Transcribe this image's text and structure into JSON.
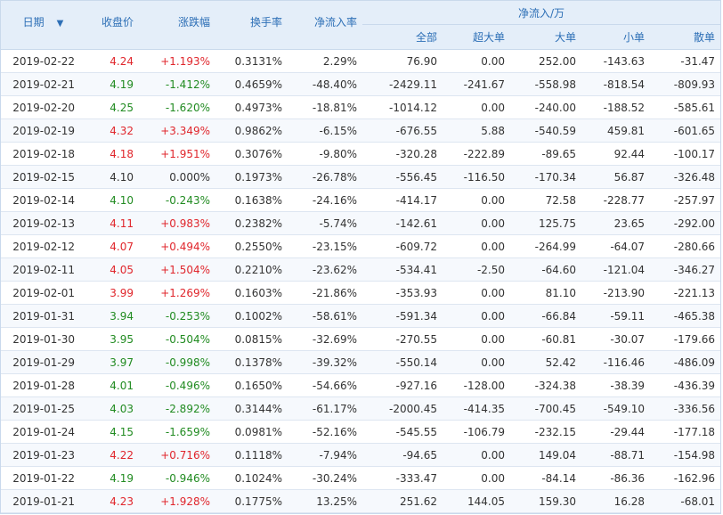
{
  "header": {
    "date": "日期",
    "close": "收盘价",
    "change": "涨跌幅",
    "turnover": "换手率",
    "net_pct": "净流入率",
    "net_group": "净流入/万",
    "all": "全部",
    "super_large": "超大单",
    "large": "大单",
    "small": "小单",
    "retail": "散单"
  },
  "sort_icon": "arrow-down-icon",
  "colors": {
    "up": "#e0262c",
    "down": "#218b21",
    "header_text": "#2d6fb6",
    "header_bg": "#e4eef9"
  },
  "rows": [
    {
      "date": "2019-02-22",
      "close": "4.24",
      "change": "+1.193%",
      "turnover": "0.3131%",
      "net_pct": "2.29%",
      "all": "76.90",
      "super": "0.00",
      "big": "252.00",
      "small": "-143.63",
      "retail": "-31.47",
      "trend": "up"
    },
    {
      "date": "2019-02-21",
      "close": "4.19",
      "change": "-1.412%",
      "turnover": "0.4659%",
      "net_pct": "-48.40%",
      "all": "-2429.11",
      "super": "-241.67",
      "big": "-558.98",
      "small": "-818.54",
      "retail": "-809.93",
      "trend": "down"
    },
    {
      "date": "2019-02-20",
      "close": "4.25",
      "change": "-1.620%",
      "turnover": "0.4973%",
      "net_pct": "-18.81%",
      "all": "-1014.12",
      "super": "0.00",
      "big": "-240.00",
      "small": "-188.52",
      "retail": "-585.61",
      "trend": "down"
    },
    {
      "date": "2019-02-19",
      "close": "4.32",
      "change": "+3.349%",
      "turnover": "0.9862%",
      "net_pct": "-6.15%",
      "all": "-676.55",
      "super": "5.88",
      "big": "-540.59",
      "small": "459.81",
      "retail": "-601.65",
      "trend": "up"
    },
    {
      "date": "2019-02-18",
      "close": "4.18",
      "change": "+1.951%",
      "turnover": "0.3076%",
      "net_pct": "-9.80%",
      "all": "-320.28",
      "super": "-222.89",
      "big": "-89.65",
      "small": "92.44",
      "retail": "-100.17",
      "trend": "up"
    },
    {
      "date": "2019-02-15",
      "close": "4.10",
      "change": "0.000%",
      "turnover": "0.1973%",
      "net_pct": "-26.78%",
      "all": "-556.45",
      "super": "-116.50",
      "big": "-170.34",
      "small": "56.87",
      "retail": "-326.48",
      "trend": "flat"
    },
    {
      "date": "2019-02-14",
      "close": "4.10",
      "change": "-0.243%",
      "turnover": "0.1638%",
      "net_pct": "-24.16%",
      "all": "-414.17",
      "super": "0.00",
      "big": "72.58",
      "small": "-228.77",
      "retail": "-257.97",
      "trend": "down"
    },
    {
      "date": "2019-02-13",
      "close": "4.11",
      "change": "+0.983%",
      "turnover": "0.2382%",
      "net_pct": "-5.74%",
      "all": "-142.61",
      "super": "0.00",
      "big": "125.75",
      "small": "23.65",
      "retail": "-292.00",
      "trend": "up"
    },
    {
      "date": "2019-02-12",
      "close": "4.07",
      "change": "+0.494%",
      "turnover": "0.2550%",
      "net_pct": "-23.15%",
      "all": "-609.72",
      "super": "0.00",
      "big": "-264.99",
      "small": "-64.07",
      "retail": "-280.66",
      "trend": "up"
    },
    {
      "date": "2019-02-11",
      "close": "4.05",
      "change": "+1.504%",
      "turnover": "0.2210%",
      "net_pct": "-23.62%",
      "all": "-534.41",
      "super": "-2.50",
      "big": "-64.60",
      "small": "-121.04",
      "retail": "-346.27",
      "trend": "up"
    },
    {
      "date": "2019-02-01",
      "close": "3.99",
      "change": "+1.269%",
      "turnover": "0.1603%",
      "net_pct": "-21.86%",
      "all": "-353.93",
      "super": "0.00",
      "big": "81.10",
      "small": "-213.90",
      "retail": "-221.13",
      "trend": "up"
    },
    {
      "date": "2019-01-31",
      "close": "3.94",
      "change": "-0.253%",
      "turnover": "0.1002%",
      "net_pct": "-58.61%",
      "all": "-591.34",
      "super": "0.00",
      "big": "-66.84",
      "small": "-59.11",
      "retail": "-465.38",
      "trend": "down"
    },
    {
      "date": "2019-01-30",
      "close": "3.95",
      "change": "-0.504%",
      "turnover": "0.0815%",
      "net_pct": "-32.69%",
      "all": "-270.55",
      "super": "0.00",
      "big": "-60.81",
      "small": "-30.07",
      "retail": "-179.66",
      "trend": "down"
    },
    {
      "date": "2019-01-29",
      "close": "3.97",
      "change": "-0.998%",
      "turnover": "0.1378%",
      "net_pct": "-39.32%",
      "all": "-550.14",
      "super": "0.00",
      "big": "52.42",
      "small": "-116.46",
      "retail": "-486.09",
      "trend": "down"
    },
    {
      "date": "2019-01-28",
      "close": "4.01",
      "change": "-0.496%",
      "turnover": "0.1650%",
      "net_pct": "-54.66%",
      "all": "-927.16",
      "super": "-128.00",
      "big": "-324.38",
      "small": "-38.39",
      "retail": "-436.39",
      "trend": "down"
    },
    {
      "date": "2019-01-25",
      "close": "4.03",
      "change": "-2.892%",
      "turnover": "0.3144%",
      "net_pct": "-61.17%",
      "all": "-2000.45",
      "super": "-414.35",
      "big": "-700.45",
      "small": "-549.10",
      "retail": "-336.56",
      "trend": "down"
    },
    {
      "date": "2019-01-24",
      "close": "4.15",
      "change": "-1.659%",
      "turnover": "0.0981%",
      "net_pct": "-52.16%",
      "all": "-545.55",
      "super": "-106.79",
      "big": "-232.15",
      "small": "-29.44",
      "retail": "-177.18",
      "trend": "down"
    },
    {
      "date": "2019-01-23",
      "close": "4.22",
      "change": "+0.716%",
      "turnover": "0.1118%",
      "net_pct": "-7.94%",
      "all": "-94.65",
      "super": "0.00",
      "big": "149.04",
      "small": "-88.71",
      "retail": "-154.98",
      "trend": "up"
    },
    {
      "date": "2019-01-22",
      "close": "4.19",
      "change": "-0.946%",
      "turnover": "0.1024%",
      "net_pct": "-30.24%",
      "all": "-333.47",
      "super": "0.00",
      "big": "-84.14",
      "small": "-86.36",
      "retail": "-162.96",
      "trend": "down"
    },
    {
      "date": "2019-01-21",
      "close": "4.23",
      "change": "+1.928%",
      "turnover": "0.1775%",
      "net_pct": "13.25%",
      "all": "251.62",
      "super": "144.05",
      "big": "159.30",
      "small": "16.28",
      "retail": "-68.01",
      "trend": "up"
    }
  ]
}
